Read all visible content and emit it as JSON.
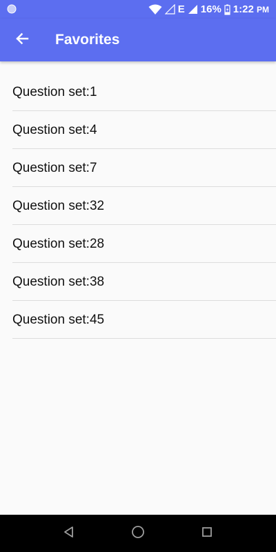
{
  "status_bar": {
    "battery_percent": "16%",
    "time": "1:22",
    "time_suffix": "PM",
    "network_label": "E",
    "icons": [
      "notification-dot-icon",
      "wifi-icon",
      "signal-empty-icon",
      "signal-icon",
      "battery-charging-icon"
    ]
  },
  "app_bar": {
    "title": "Favorites",
    "back_icon": "arrow-back-icon",
    "color": "#5c6ef0"
  },
  "favorites": {
    "items": [
      {
        "label": "Question set:1"
      },
      {
        "label": "Question set:4"
      },
      {
        "label": "Question set:7"
      },
      {
        "label": "Question set:32"
      },
      {
        "label": "Question set:28"
      },
      {
        "label": "Question set:38"
      },
      {
        "label": "Question set:45"
      }
    ]
  },
  "nav_bar": {
    "icons": [
      "back-triangle-icon",
      "home-circle-icon",
      "recents-square-icon"
    ]
  }
}
